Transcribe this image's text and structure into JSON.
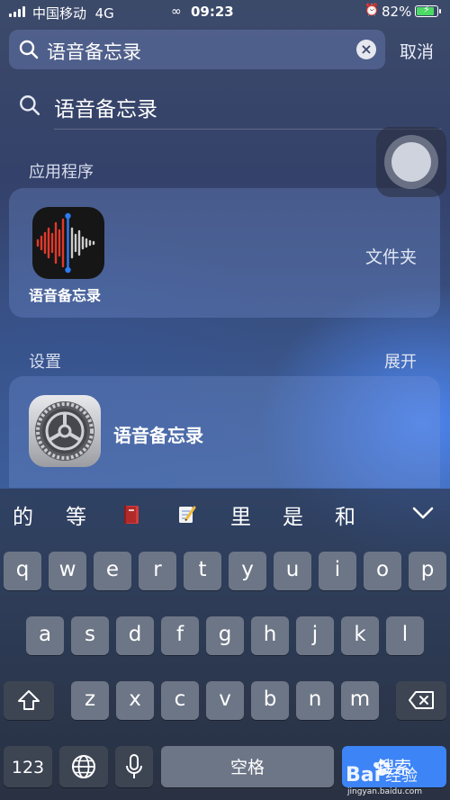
{
  "status_bar": {
    "carrier": "中国移动",
    "network": "4G",
    "time": "09:23",
    "battery": "82%",
    "battery_level": 0.82,
    "icons": [
      "signal-icon",
      "link-icon",
      "alarm-icon",
      "battery-icon"
    ]
  },
  "search": {
    "query": "语音备忘录",
    "cancel_label": "取消",
    "icons": [
      "search-icon",
      "clear-icon"
    ]
  },
  "suggestion": {
    "text": "语音备忘录"
  },
  "sections": {
    "apps": {
      "title": "应用程序",
      "app_label": "语音备忘录",
      "folder_label": "文件夹",
      "app_icon": "voice-memos-icon"
    },
    "settings": {
      "title": "设置",
      "expand_label": "展开",
      "item_label": "语音备忘录",
      "item_icon": "settings-gear-icon"
    }
  },
  "keyboard": {
    "candidates": [
      "的",
      "等",
      "里",
      "是",
      "和"
    ],
    "candidate_emojis": [
      "book-emoji",
      "memo-emoji"
    ],
    "rows": [
      [
        "q",
        "w",
        "e",
        "r",
        "t",
        "y",
        "u",
        "i",
        "o",
        "p"
      ],
      [
        "a",
        "s",
        "d",
        "f",
        "g",
        "h",
        "j",
        "k",
        "l"
      ],
      [
        "z",
        "x",
        "c",
        "v",
        "b",
        "n",
        "m"
      ]
    ],
    "numbers_label": "123",
    "space_label": "空格",
    "search_label": "搜索",
    "icons": [
      "shift-icon",
      "delete-icon",
      "globe-icon",
      "mic-icon",
      "chevron-down-icon"
    ]
  },
  "watermark": {
    "text": "Bai经验",
    "url": "jingyan.baidu.com"
  },
  "colors": {
    "accent": "#3d84f7",
    "key": "#6d7686",
    "key_dark": "#3d4553",
    "battery_fill": "#4cd964"
  }
}
